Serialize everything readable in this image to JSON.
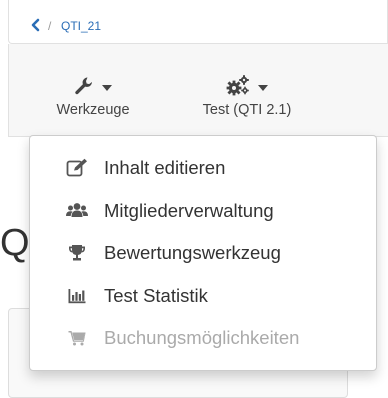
{
  "breadcrumb": {
    "separator": "/",
    "current": "QTI_21"
  },
  "toolbar": {
    "tools": [
      {
        "label": "Werkzeuge",
        "icon": "wrench-icon"
      },
      {
        "label": "Test (QTI 2.1)",
        "icon": "gears-icon"
      }
    ]
  },
  "background": {
    "heading": "Q"
  },
  "dropdown_menu": {
    "items": [
      {
        "label": "Inhalt editieren",
        "icon": "edit-icon",
        "enabled": true
      },
      {
        "label": "Mitgliederverwaltung",
        "icon": "users-icon",
        "enabled": true
      },
      {
        "label": "Bewertungswerkzeug",
        "icon": "trophy-icon",
        "enabled": true
      },
      {
        "label": "Test Statistik",
        "icon": "bar-chart-icon",
        "enabled": true
      },
      {
        "label": "Buchungsmöglichkeiten",
        "icon": "cart-icon",
        "enabled": false
      }
    ]
  },
  "colors": {
    "link": "#2a6db6",
    "text": "#333333",
    "disabled": "#aaaaaa",
    "toolbar_bg": "#f7f7f7"
  }
}
